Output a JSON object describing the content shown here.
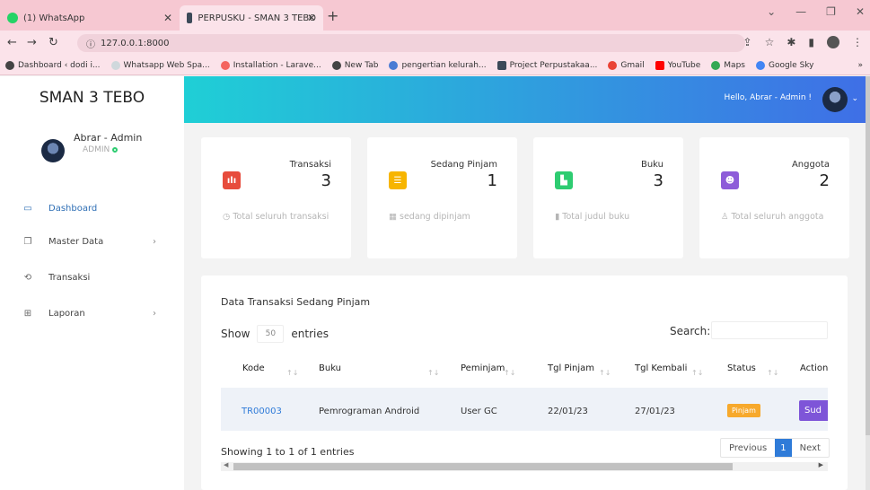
{
  "browser": {
    "tabs": [
      {
        "title": "(1) WhatsApp",
        "favicon_color": "#25d366"
      },
      {
        "title": "PERPUSKU - SMAN 3 TEBO",
        "favicon_color": "#3c4a59"
      }
    ],
    "url": "127.0.0.1:8000",
    "bookmarks": [
      {
        "label": "Dashboard ‹ dodi i...",
        "color": "#444"
      },
      {
        "label": "Whatsapp Web Spa...",
        "color": "#cfd8dc"
      },
      {
        "label": "Installation - Larave...",
        "color": "#f4645f"
      },
      {
        "label": "New Tab",
        "color": "#444"
      },
      {
        "label": "pengertian kelurah...",
        "color": "#4a7bd4"
      },
      {
        "label": "Project Perpustakaa...",
        "color": "#3c4a59"
      },
      {
        "label": "Gmail",
        "color": "#ea4335"
      },
      {
        "label": "YouTube",
        "color": "#ff0000"
      },
      {
        "label": "Maps",
        "color": "#34a853"
      },
      {
        "label": "Google Sky",
        "color": "#4285f4"
      }
    ]
  },
  "sidebar": {
    "brand": "SMAN 3 TEBO",
    "user_name": "Abrar - Admin",
    "user_role": "ADMIN",
    "items": [
      {
        "label": "Dashboard",
        "icon": "monitor-icon"
      },
      {
        "label": "Master Data",
        "icon": "copy-icon"
      },
      {
        "label": "Transaksi",
        "icon": "refresh-icon"
      },
      {
        "label": "Laporan",
        "icon": "table-icon"
      }
    ]
  },
  "header": {
    "greeting": "Hello, Abrar - Admin !"
  },
  "cards": [
    {
      "label": "Transaksi",
      "value": "3",
      "footer": "Total seluruh transaksi",
      "color": "#e74c3c",
      "icon": "chart-icon"
    },
    {
      "label": "Sedang Pinjam",
      "value": "1",
      "footer": "sedang dipinjam",
      "color": "#f7b500",
      "icon": "list-icon"
    },
    {
      "label": "Buku",
      "value": "3",
      "footer": "Total judul buku",
      "color": "#2ecc71",
      "icon": "book-icon"
    },
    {
      "label": "Anggota",
      "value": "2",
      "footer": "Total seluruh anggota",
      "color": "#8e5cd9",
      "icon": "user-icon"
    }
  ],
  "table": {
    "title": "Data Transaksi Sedang Pinjam",
    "show_label": "Show",
    "entries_value": "50",
    "entries_label": "entries",
    "search_label": "Search:",
    "columns": [
      "Kode",
      "Buku",
      "Peminjam",
      "Tgl Pinjam",
      "Tgl Kembali",
      "Status",
      "Action"
    ],
    "rows": [
      {
        "kode": "TR00003",
        "buku": "Pemrograman Android",
        "peminjam": "User GC",
        "tgl_pinjam": "22/01/23",
        "tgl_kembali": "27/01/23",
        "status": "Pinjam",
        "action": "Sud"
      }
    ],
    "info": "Showing 1 to 1 of 1 entries",
    "pager": {
      "prev": "Previous",
      "current": "1",
      "next": "Next"
    }
  }
}
